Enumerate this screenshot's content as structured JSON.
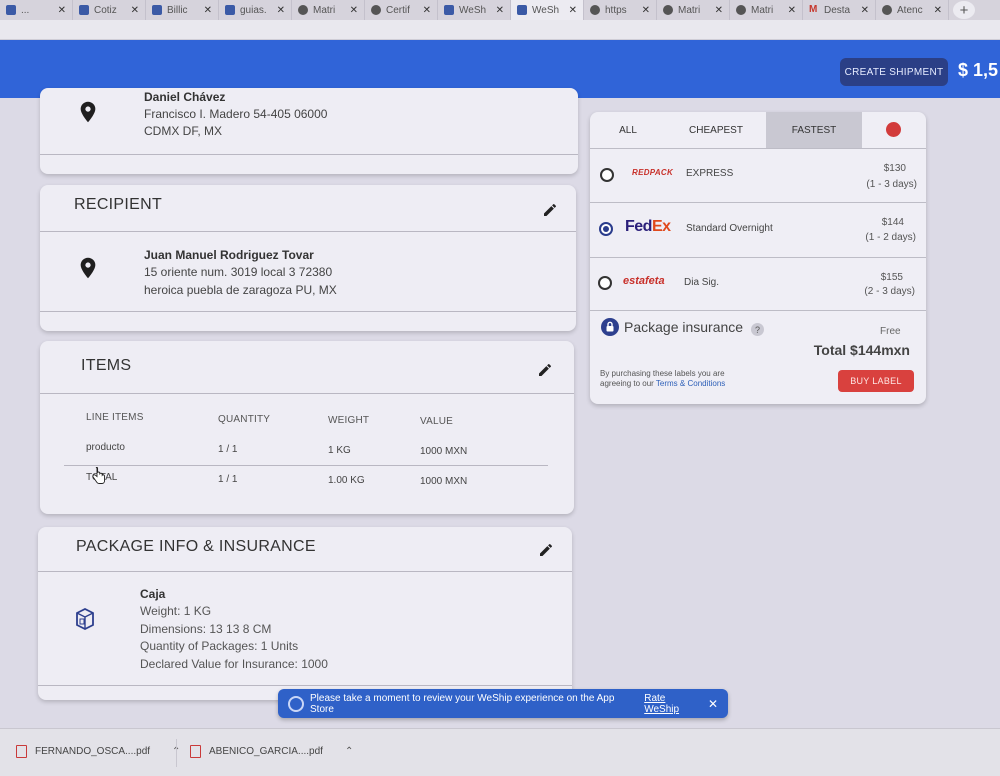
{
  "browser": {
    "tabs": [
      {
        "label": "...",
        "active": false
      },
      {
        "label": "Cotiz",
        "active": false
      },
      {
        "label": "Billic",
        "active": false
      },
      {
        "label": "guias.",
        "active": false
      },
      {
        "label": "Matri",
        "active": false
      },
      {
        "label": "Certif",
        "active": false
      },
      {
        "label": "WeSh",
        "active": false
      },
      {
        "label": "WeSh",
        "active": true
      },
      {
        "label": "https",
        "active": false
      },
      {
        "label": "Matri",
        "active": false
      },
      {
        "label": "Matri",
        "active": false
      },
      {
        "label": "Desta",
        "active": false
      },
      {
        "label": "Atenc",
        "active": false
      }
    ],
    "new_tab_label": "+",
    "close_glyph": "✕"
  },
  "header": {
    "create_shipment_label": "CREATE SHIPMENT",
    "balance": "$ 1,5"
  },
  "sender": {
    "name": "Daniel Chávez",
    "line1": "Francisco I. Madero 54-405 06000",
    "line2": "CDMX DF, MX"
  },
  "recipient": {
    "title": "RECIPIENT",
    "name": "Juan Manuel Rodriguez Tovar",
    "line1": "15 oriente num. 3019 local 3 72380",
    "line2": "heroica puebla de zaragoza PU, MX"
  },
  "items": {
    "title": "ITEMS",
    "headers": [
      "LINE ITEMS",
      "QUANTITY",
      "WEIGHT",
      "VALUE"
    ],
    "rows": [
      [
        "producto",
        "1 / 1",
        "1 KG",
        "1000 MXN"
      ],
      [
        "TOTAL",
        "1 / 1",
        "1.00 KG",
        "1000 MXN"
      ]
    ]
  },
  "package": {
    "title": "PACKAGE INFO & INSURANCE",
    "name": "Caja",
    "weight": "Weight: 1 KG",
    "dimensions": "Dimensions: 13 13 8 CM",
    "quantity": "Quantity of Packages: 1 Units",
    "declared": "Declared Value for Insurance: 1000"
  },
  "rates": {
    "tabs": [
      "ALL",
      "CHEAPEST",
      "FASTEST"
    ],
    "selected_tab": "FASTEST",
    "options": [
      {
        "carrier": "REDPACK",
        "service": "EXPRESS",
        "price": "$130",
        "eta": "(1 - 3 days)",
        "selected": false,
        "logo_color": "#c8302a"
      },
      {
        "carrier_a": "Fed",
        "carrier_b": "Ex",
        "service": "Standard Overnight",
        "price": "$144",
        "eta": "(1 - 2 days)",
        "selected": true,
        "logo_color_a": "#2b1f7a",
        "logo_color_b": "#e0491c"
      },
      {
        "carrier": "estafeta",
        "service": "Dia Sig.",
        "price": "$155",
        "eta": "(2 - 3 days)",
        "selected": false,
        "logo_color": "#c8302a"
      }
    ],
    "insurance_label": "Package insurance",
    "help_glyph": "?",
    "insurance_price": "Free",
    "total": "Total $144mxn",
    "fine_print": "By purchasing these labels you are agreeing to our",
    "terms_link": "Terms & Conditions",
    "buy_label": "BUY LABEL"
  },
  "toast": {
    "message": "Please take a moment to review your WeShip experience on the App Store",
    "link": "Rate WeShip",
    "close": "✕"
  },
  "downloads": [
    {
      "name": "FERNANDO_OSCA....pdf"
    },
    {
      "name": "ABENICO_GARCIA....pdf"
    }
  ],
  "colors": {
    "appbar": "#3064d8",
    "buy_button": "#d9413e",
    "toast": "#2f61c8"
  }
}
